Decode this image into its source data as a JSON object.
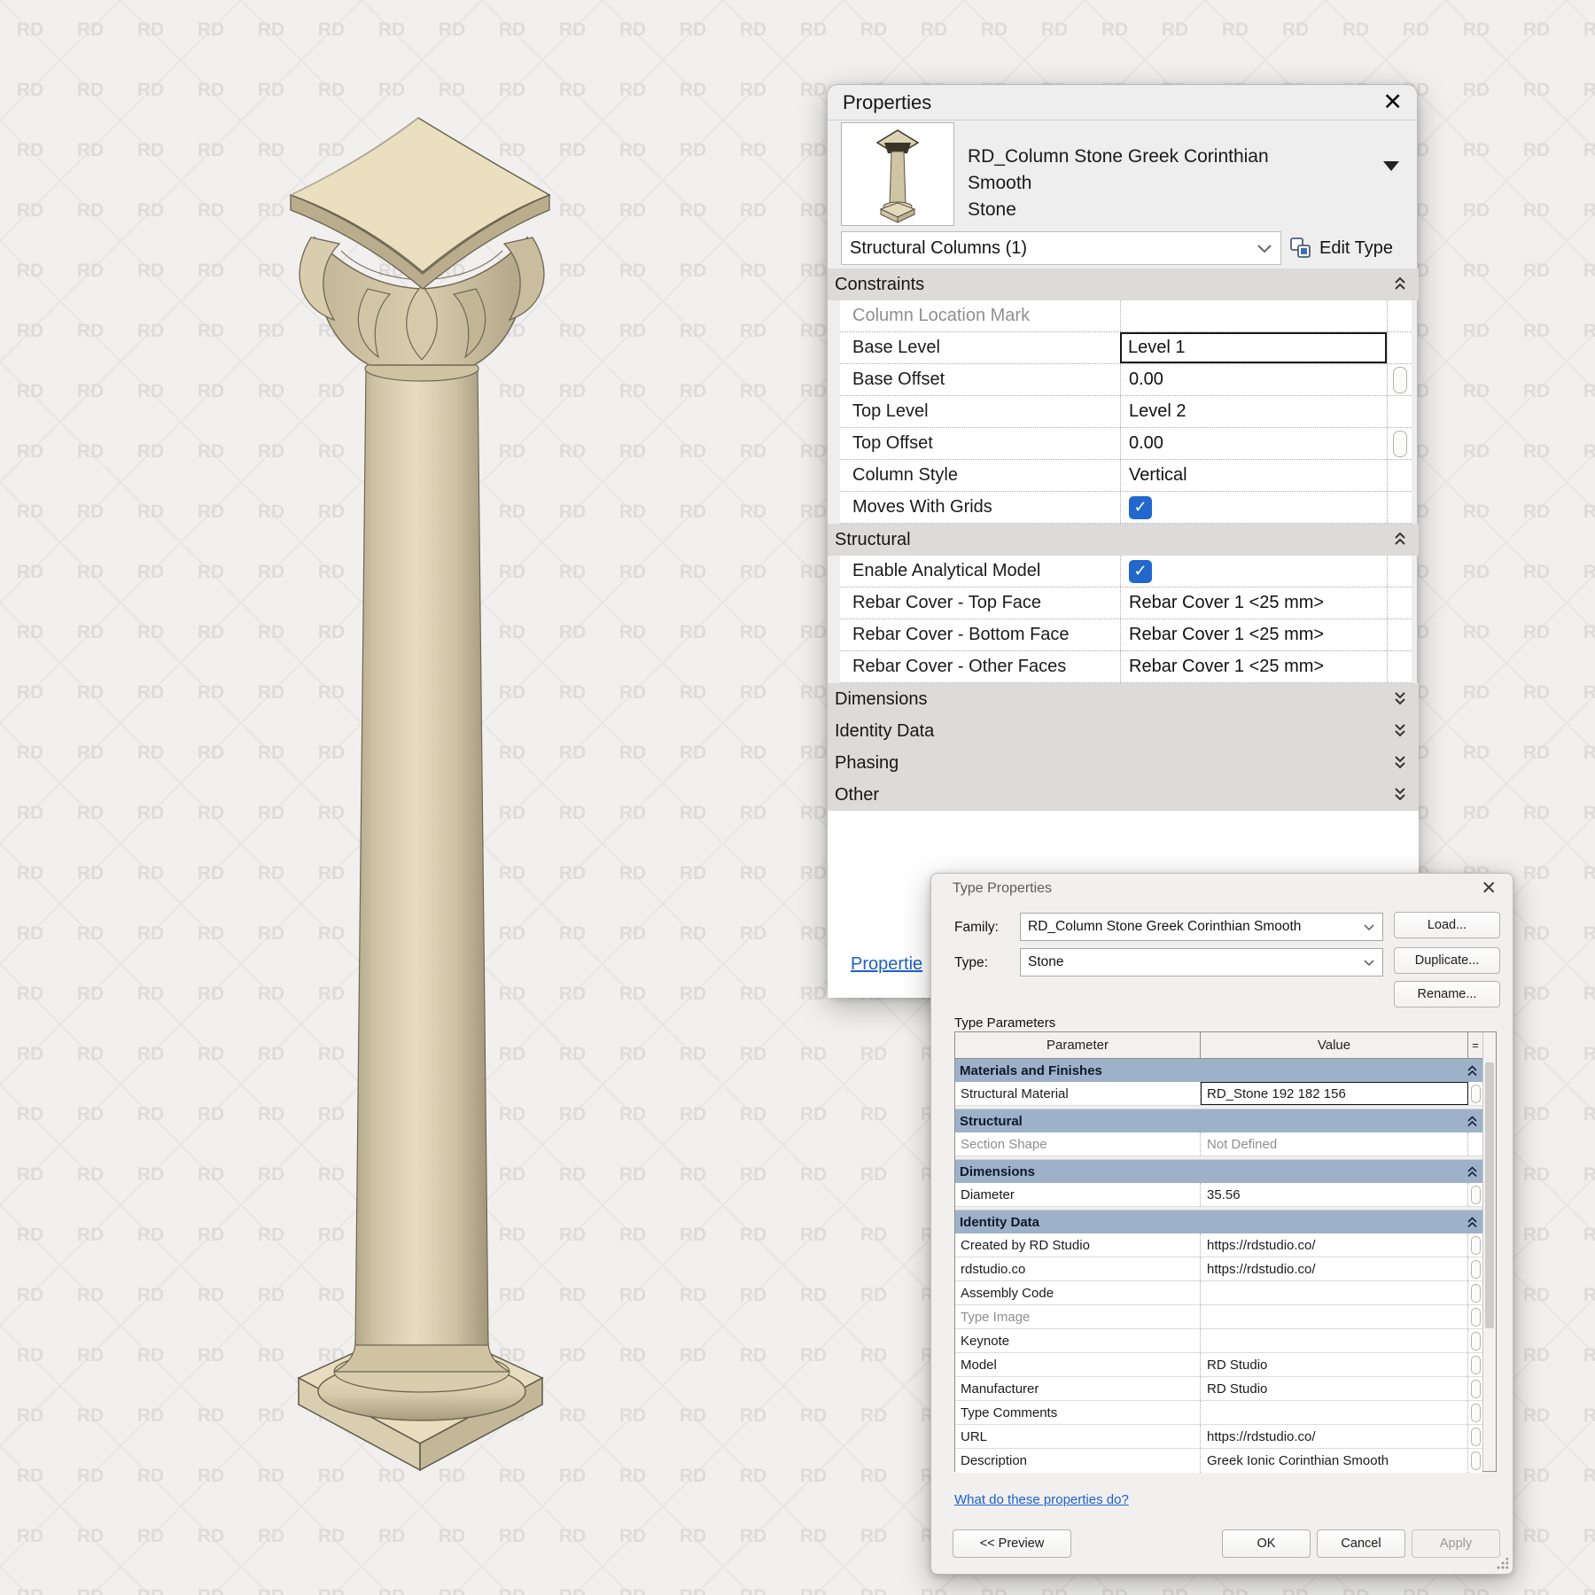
{
  "watermark": {
    "text": "RD"
  },
  "colors": {
    "background": "#f1f0ef",
    "watermark_text": "#dddcdb",
    "watermark_lines": "#e7e6e5",
    "panel_bg": "#efeeee",
    "section_header_gray": "#dcdbda",
    "group_header_blue": "#9db1c9",
    "checkbox_blue": "#2268cc",
    "link_blue": "#1a5fd0",
    "stone_light": "#e8ddbe",
    "stone_mid": "#cfc3a2",
    "stone_dark": "#ab9f80"
  },
  "properties_panel": {
    "title": "Properties",
    "close_icon": "✕",
    "type_name_line1": "RD_Column Stone Greek Corinthian Smooth",
    "type_name_line2": "Stone",
    "selector": "Structural Columns (1)",
    "edit_type_label": "Edit Type",
    "constraints": {
      "header": "Constraints",
      "rows": [
        {
          "p": "Column Location Mark",
          "v": ""
        },
        {
          "p": "Base Level",
          "v": "Level 1"
        },
        {
          "p": "Base Offset",
          "v": "0.00"
        },
        {
          "p": "Top Level",
          "v": "Level 2"
        },
        {
          "p": "Top Offset",
          "v": "0.00"
        },
        {
          "p": "Column Style",
          "v": "Vertical"
        },
        {
          "p": "Moves With Grids",
          "v": "checked"
        }
      ]
    },
    "structural": {
      "header": "Structural",
      "rows": [
        {
          "p": "Enable Analytical Model",
          "v": "checked"
        },
        {
          "p": "Rebar Cover - Top Face",
          "v": "Rebar Cover 1 <25 mm>"
        },
        {
          "p": "Rebar Cover - Bottom Face",
          "v": "Rebar Cover 1 <25 mm>"
        },
        {
          "p": "Rebar Cover - Other Faces",
          "v": "Rebar Cover 1 <25 mm>"
        }
      ]
    },
    "collapsed_sections": [
      "Dimensions",
      "Identity Data",
      "Phasing",
      "Other"
    ],
    "bottom_link": "Propertie"
  },
  "type_properties": {
    "title": "Type Properties",
    "close_icon": "✕",
    "family_label": "Family:",
    "family_value": "RD_Column Stone Greek Corinthian Smooth",
    "type_label": "Type:",
    "type_value": "Stone",
    "load_button": "Load...",
    "duplicate_button": "Duplicate...",
    "rename_button": "Rename...",
    "type_parameters_label": "Type Parameters",
    "table": {
      "header_parameter": "Parameter",
      "header_value": "Value",
      "header_eq": "=",
      "groups": [
        {
          "name": "Materials and Finishes",
          "rows": [
            {
              "p": "Structural Material",
              "v": "RD_Stone 192 182 156"
            }
          ]
        },
        {
          "name": "Structural",
          "rows": [
            {
              "p": "Section Shape",
              "v": "Not Defined"
            }
          ]
        },
        {
          "name": "Dimensions",
          "rows": [
            {
              "p": "Diameter",
              "v": "35.56"
            }
          ]
        },
        {
          "name": "Identity Data",
          "rows": [
            {
              "p": "Created by RD Studio",
              "v": "https://rdstudio.co/"
            },
            {
              "p": "rdstudio.co",
              "v": "https://rdstudio.co/"
            },
            {
              "p": "Assembly Code",
              "v": ""
            },
            {
              "p": "Type Image",
              "v": ""
            },
            {
              "p": "Keynote",
              "v": ""
            },
            {
              "p": "Model",
              "v": "RD Studio"
            },
            {
              "p": "Manufacturer",
              "v": "RD Studio"
            },
            {
              "p": "Type Comments",
              "v": ""
            },
            {
              "p": "URL",
              "v": "https://rdstudio.co/"
            },
            {
              "p": "Description",
              "v": "Greek Ionic Corinthian Smooth"
            }
          ]
        }
      ]
    },
    "help_link": "What do these properties do?",
    "preview_button": "<< Preview",
    "ok_button": "OK",
    "cancel_button": "Cancel",
    "apply_button": "Apply"
  }
}
